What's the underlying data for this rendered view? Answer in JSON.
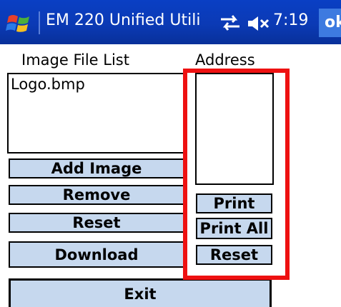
{
  "titlebar": {
    "title": "EM 220 Unified Utili",
    "time": "7:19",
    "ok_label": "ok",
    "start_icon": "windows-flag-icon",
    "connectivity_icon": "connectivity-icon",
    "volume_icon": "volume-muted-icon",
    "colors": {
      "bar": "#0b3ab5",
      "ok": "#3d7ae0"
    }
  },
  "image_list": {
    "label": "Image File List",
    "items": [
      "Logo.bmp"
    ]
  },
  "address": {
    "label": "Address"
  },
  "buttons": {
    "add_image": "Add Image",
    "remove": "Remove",
    "reset_left": "Reset",
    "download": "Download",
    "print": "Print",
    "print_all": "Print All",
    "reset_right": "Reset",
    "exit": "Exit"
  },
  "colors": {
    "button_face": "#c6d8ee",
    "highlight": "#ee1111"
  }
}
